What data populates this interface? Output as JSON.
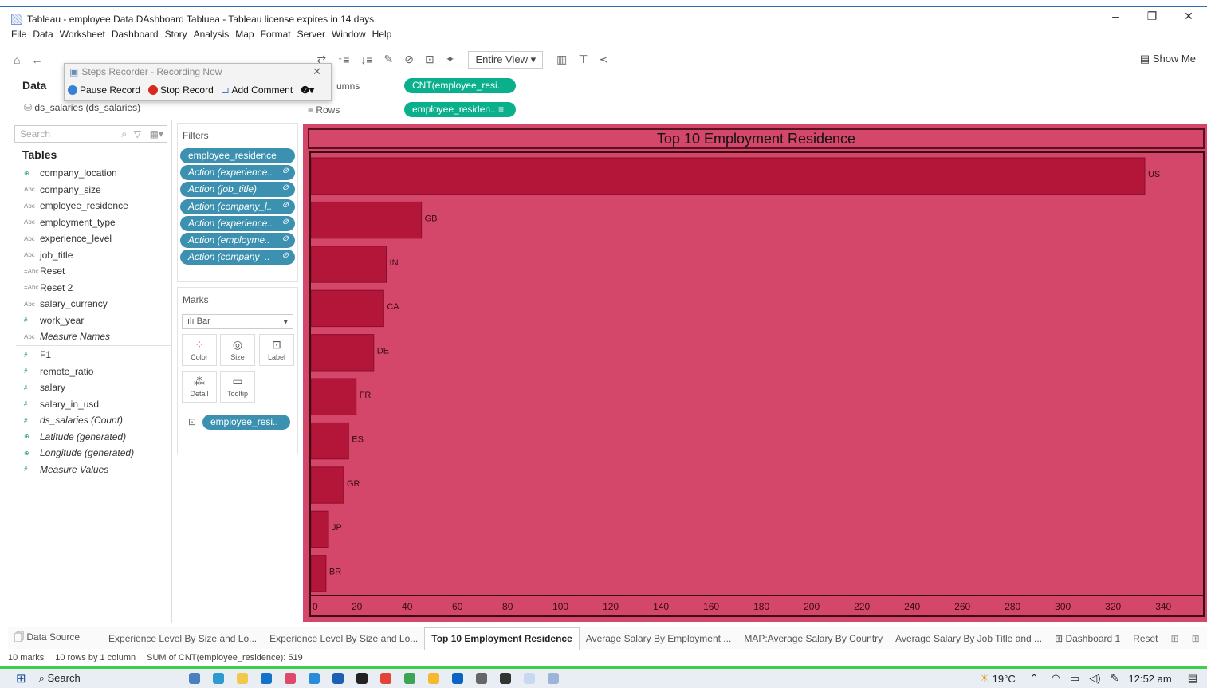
{
  "window": {
    "title": "Tableau - employee Data DAshboard Tabluea - Tableau license expires in 14 days",
    "controls": [
      "–",
      "❐",
      "✕"
    ]
  },
  "menu": [
    "File",
    "Data",
    "Worksheet",
    "Dashboard",
    "Story",
    "Analysis",
    "Map",
    "Format",
    "Server",
    "Window",
    "Help"
  ],
  "toolbar": {
    "fit_label": "Entire View",
    "show_me_label": "Show Me"
  },
  "steps_recorder": {
    "title": "Steps Recorder - Recording Now",
    "pause_label": "Pause Record",
    "stop_label": "Stop Record",
    "comment_label": "Add Comment"
  },
  "data_pane": {
    "header": "Data",
    "datasource": "ds_salaries (ds_salaries)",
    "search_placeholder": "Search",
    "tables_header": "Tables",
    "dimensions": [
      {
        "type": "⊕",
        "name": "company_location"
      },
      {
        "type": "Abc",
        "name": "company_size"
      },
      {
        "type": "Abc",
        "name": "employee_residence"
      },
      {
        "type": "Abc",
        "name": "employment_type"
      },
      {
        "type": "Abc",
        "name": "experience_level"
      },
      {
        "type": "Abc",
        "name": "job_title"
      },
      {
        "type": "=Abc",
        "name": "Reset"
      },
      {
        "type": "=Abc",
        "name": "Reset 2"
      },
      {
        "type": "Abc",
        "name": "salary_currency"
      },
      {
        "type": "#",
        "name": "work_year"
      },
      {
        "type": "Abc",
        "name": "Measure Names"
      }
    ],
    "measures": [
      {
        "type": "#",
        "name": "F1"
      },
      {
        "type": "#",
        "name": "remote_ratio"
      },
      {
        "type": "#",
        "name": "salary"
      },
      {
        "type": "#",
        "name": "salary_in_usd"
      },
      {
        "type": "#",
        "name": "ds_salaries (Count)"
      },
      {
        "type": "⊕",
        "name": "Latitude (generated)"
      },
      {
        "type": "⊕",
        "name": "Longitude (generated)"
      },
      {
        "type": "#",
        "name": "Measure Values"
      }
    ]
  },
  "filters": {
    "header": "Filters",
    "items": [
      "employee_residence",
      "Action (experience..",
      "Action (job_title)",
      "Action (company_l..",
      "Action (experience..",
      "Action (employme..",
      "Action (company_.."
    ]
  },
  "marks": {
    "header": "Marks",
    "type": "Bar",
    "buttons": [
      "Color",
      "Size",
      "Label",
      "Detail",
      "Tooltip"
    ],
    "label_pill": "employee_resi.."
  },
  "shelves": {
    "columns_label": "umns",
    "columns_pill": "CNT(employee_resi..",
    "rows_label": "Rows",
    "rows_pill": "employee_residen.."
  },
  "chart_data": {
    "type": "bar",
    "orientation": "horizontal",
    "title": "Top 10 Employment  Residence",
    "categories": [
      "US",
      "GB",
      "IN",
      "CA",
      "DE",
      "FR",
      "ES",
      "GR",
      "JP",
      "BR"
    ],
    "values": [
      332,
      44,
      30,
      29,
      25,
      18,
      15,
      13,
      7,
      6
    ],
    "xlim": [
      0,
      350
    ],
    "xticks": [
      0,
      20,
      40,
      60,
      80,
      100,
      120,
      140,
      160,
      180,
      200,
      220,
      240,
      260,
      280,
      300,
      320,
      340
    ],
    "colors": {
      "background": "#d4476a",
      "bar": "#b4163a"
    }
  },
  "tabs": [
    "🗍 Data Source",
    "Experience Level By Size and Lo...",
    "Experience Level By Size and Lo...",
    "Top 10 Employment  Residence",
    "Average Salary By Employment ...",
    "MAP:Average Salary By Country",
    "Average Salary By Job Title and ...",
    "⊞ Dashboard 1",
    "Reset"
  ],
  "status": {
    "marks": "10 marks",
    "rows": "10 rows by 1 column",
    "sum": "SUM of CNT(employee_residence): 519"
  },
  "taskbar": {
    "search": "Search",
    "weather": "19°C",
    "time": "12:52 am"
  }
}
